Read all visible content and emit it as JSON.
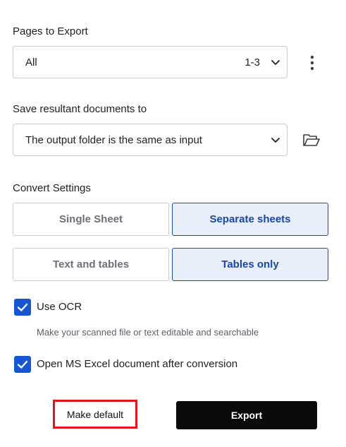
{
  "pages": {
    "label": "Pages to Export",
    "value": "All",
    "range": "1-3"
  },
  "output": {
    "label": "Save resultant documents to",
    "value": "The output folder is the same as input"
  },
  "convert": {
    "label": "Convert Settings",
    "sheet_options": [
      {
        "label": "Single Sheet",
        "active": false
      },
      {
        "label": "Separate sheets",
        "active": true
      }
    ],
    "content_options": [
      {
        "label": "Text and tables",
        "active": false
      },
      {
        "label": "Tables only",
        "active": true
      }
    ]
  },
  "ocr": {
    "label": "Use OCR",
    "checked": true,
    "hint": "Make your scanned file or text editable and searchable"
  },
  "open_excel": {
    "label": "Open MS Excel document after conversion",
    "checked": true
  },
  "buttons": {
    "make_default": "Make default",
    "export": "Export"
  },
  "icons": {
    "more": "more-vertical-icon",
    "folder": "folder-open-icon",
    "chevron": "chevron-down-icon",
    "check": "checkmark-icon"
  },
  "colors": {
    "accent": "#1456d4",
    "active_segment_bg": "#e8effb",
    "active_segment_text": "#1a47a0",
    "highlight_border": "#e0141b",
    "export_bg": "#0a0a0c"
  }
}
